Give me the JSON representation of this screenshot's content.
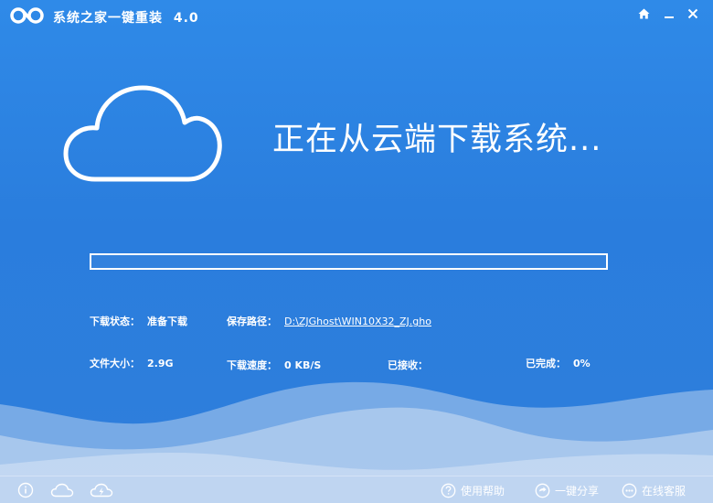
{
  "window": {
    "title": "系统之家一键重装",
    "version": "4.0"
  },
  "icons": {
    "logo": "app-logo-icon",
    "home": "home-icon",
    "minimize": "minimize-icon",
    "close": "close-icon",
    "cloud": "cloud-icon"
  },
  "main": {
    "headline": "正在从云端下载系统...",
    "progress_percent": 0
  },
  "info": {
    "status_label": "下载状态：",
    "status_value": "准备下载",
    "path_label": "保存路径：",
    "path_value": "D:\\ZJGhost\\WIN10X32_ZJ.gho",
    "size_label": "文件大小：",
    "size_value": "2.9G",
    "speed_label": "下载速度：",
    "speed_value": "0 KB/S",
    "received_label": "已接收：",
    "received_value": "",
    "completed_label": "已完成：",
    "completed_value": "0%"
  },
  "bottom": {
    "help_label": "使用帮助",
    "share_label": "一键分享",
    "service_label": "在线客服"
  },
  "colors": {
    "background": "#2f8ae8",
    "accent": "#ffffff",
    "wave_light": "#bcd3ef"
  }
}
